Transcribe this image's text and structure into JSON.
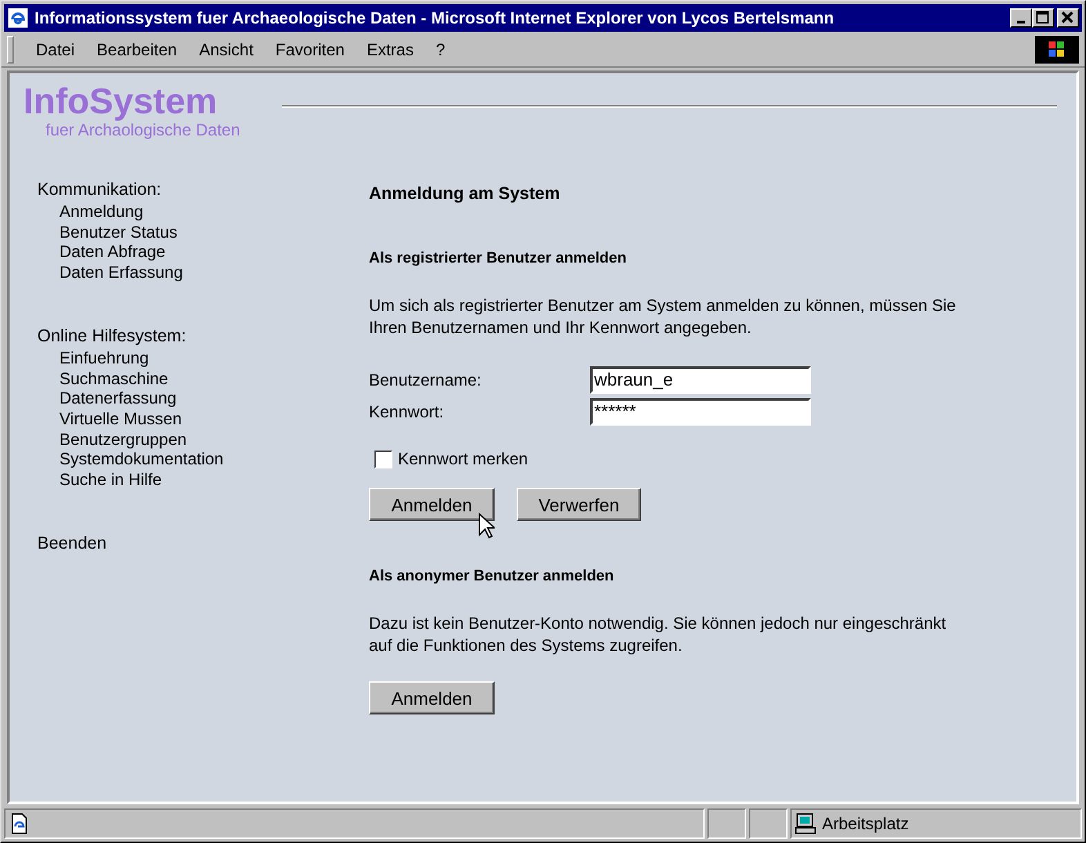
{
  "window": {
    "title": "Informationssystem fuer Archaeologische Daten - Microsoft Internet Explorer von Lycos Bertelsmann"
  },
  "menu": [
    "Datei",
    "Bearbeiten",
    "Ansicht",
    "Favoriten",
    "Extras",
    "?"
  ],
  "logo": {
    "title": "InfoSystem",
    "subtitle": "fuer Archaologische Daten"
  },
  "sidebar": [
    {
      "heading": "Kommunikation:",
      "items": [
        "Anmeldung",
        "Benutzer Status",
        "Daten Abfrage",
        "Daten Erfassung"
      ]
    },
    {
      "heading": "Online Hilfesystem:",
      "items": [
        "Einfuehrung",
        "Suchmaschine",
        "Datenerfassung",
        "Virtuelle Mussen",
        "Benutzergruppen",
        "Systemdokumentation",
        "Suche in Hilfe"
      ]
    },
    {
      "heading": "Beenden"
    }
  ],
  "main": {
    "title": "Anmeldung am System",
    "registered": {
      "heading": "Als registrierter Benutzer anmelden",
      "text": "Um sich als registrierter Benutzer am System anmelden zu können, müssen Sie Ihren Benutzernamen und Ihr Kennwort angegeben.",
      "fields": [
        {
          "label": "Benutzername:",
          "value": "wbraun_e"
        },
        {
          "label": "Kennwort:",
          "value": "******"
        }
      ],
      "remember": {
        "label": "Kennwort merken",
        "checked": false
      },
      "buttons": [
        "Anmelden",
        "Verwerfen"
      ]
    },
    "anonymous": {
      "heading": "Als anonymer Benutzer anmelden",
      "text": "Dazu ist kein Benutzer-Konto notwendig. Sie können jedoch nur eingeschränkt auf die Funktionen des Systems zugreifen.",
      "buttons": [
        "Anmelden"
      ]
    }
  },
  "status_bar": {
    "zone": "Arbeitsplatz"
  }
}
